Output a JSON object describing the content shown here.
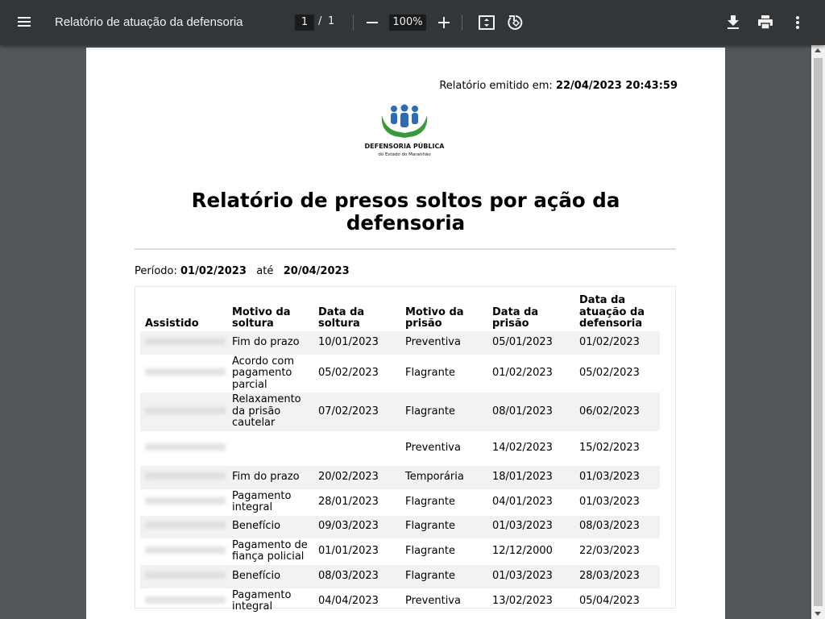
{
  "toolbar": {
    "title": "Relatório de atuação da defensoria",
    "current_page": "1",
    "page_separator": "/",
    "total_pages": "1",
    "zoom": "100%",
    "icons": [
      "menu-icon",
      "zoom-out-icon",
      "zoom-in-icon",
      "fit-page-icon",
      "rotate-icon",
      "download-icon",
      "print-icon",
      "more-vert-icon"
    ]
  },
  "report": {
    "issued_label": "Relatório emitido em:",
    "issued_value": "22/04/2023 20:43:59",
    "logo_line1": "DEFENSORIA PÚBLICA",
    "logo_line2": "do Estado do Maranhão",
    "title": "Relatório de presos soltos por ação da defensoria",
    "period_label": "Período:",
    "period_start": "01/02/2023",
    "period_until": "até",
    "period_end": "20/04/2023"
  },
  "table": {
    "headers": [
      "Assistido",
      "Motivo da soltura",
      "Data da soltura",
      "Motivo da prisão",
      "Data da prisão",
      "Data da atuação da defensoria"
    ],
    "rows": [
      {
        "motivo_soltura": "Fim do prazo",
        "data_soltura": "10/01/2023",
        "motivo_prisao": "Preventiva",
        "data_prisao": "05/01/2023",
        "data_atuacao": "01/02/2023"
      },
      {
        "motivo_soltura": "Acordo com pagamento parcial",
        "data_soltura": "05/02/2023",
        "motivo_prisao": "Flagrante",
        "data_prisao": "01/02/2023",
        "data_atuacao": "05/02/2023"
      },
      {
        "motivo_soltura": "Relaxamento da prisão cautelar",
        "data_soltura": "07/02/2023",
        "motivo_prisao": "Flagrante",
        "data_prisao": "08/01/2023",
        "data_atuacao": "06/02/2023"
      },
      {
        "motivo_soltura": "",
        "data_soltura": "",
        "motivo_prisao": "Preventiva",
        "data_prisao": "14/02/2023",
        "data_atuacao": "15/02/2023"
      },
      {
        "motivo_soltura": "Fim do prazo",
        "data_soltura": "20/02/2023",
        "motivo_prisao": "Temporária",
        "data_prisao": "18/01/2023",
        "data_atuacao": "01/03/2023"
      },
      {
        "motivo_soltura": "Pagamento integral",
        "data_soltura": "28/01/2023",
        "motivo_prisao": "Flagrante",
        "data_prisao": "04/01/2023",
        "data_atuacao": "01/03/2023"
      },
      {
        "motivo_soltura": "Benefício",
        "data_soltura": "09/03/2023",
        "motivo_prisao": "Flagrante",
        "data_prisao": "01/03/2023",
        "data_atuacao": "08/03/2023"
      },
      {
        "motivo_soltura": "Pagamento de fiança policial",
        "data_soltura": "01/01/2023",
        "motivo_prisao": "Flagrante",
        "data_prisao": "12/12/2000",
        "data_atuacao": "22/03/2023"
      },
      {
        "motivo_soltura": "Benefício",
        "data_soltura": "08/03/2023",
        "motivo_prisao": "Flagrante",
        "data_prisao": "01/03/2023",
        "data_atuacao": "28/03/2023"
      },
      {
        "motivo_soltura": "Pagamento integral",
        "data_soltura": "04/04/2023",
        "motivo_prisao": "Preventiva",
        "data_prisao": "13/02/2023",
        "data_atuacao": "05/04/2023"
      }
    ]
  },
  "colors": {
    "toolbar_bg": "#323639",
    "viewer_bg": "#525659",
    "logo_blue": "#2a6db5",
    "logo_green": "#3a9a3a"
  }
}
